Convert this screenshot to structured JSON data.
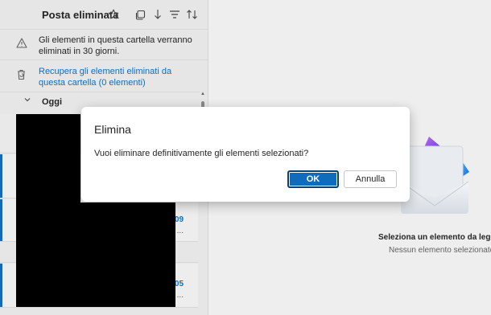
{
  "folder": {
    "title": "Posta eliminata",
    "toolbar_icons": [
      "star-icon",
      "select-icon",
      "sort-icon",
      "filter-icon",
      "sort-order-icon"
    ]
  },
  "info": {
    "retention_text": "Gli elementi in questa cartella verranno eliminati in 30 giorni.",
    "recover_link": "Recupera gli elementi eliminati da questa cartella (0 elementi)"
  },
  "group": {
    "label": "Oggi"
  },
  "mail_items": [
    {
      "time": ":09",
      "more": "..."
    },
    {
      "time": ":05",
      "more": "..."
    }
  ],
  "reading_pane": {
    "title": "Seleziona un elemento da legge",
    "subtitle": "Nessun elemento selezionato"
  },
  "dialog": {
    "title": "Elimina",
    "message": "Vuoi eliminare definitivamente gli elementi selezionati?",
    "ok_label": "OK",
    "cancel_label": "Annulla"
  },
  "colors": {
    "accent": "#0f6cbd"
  }
}
